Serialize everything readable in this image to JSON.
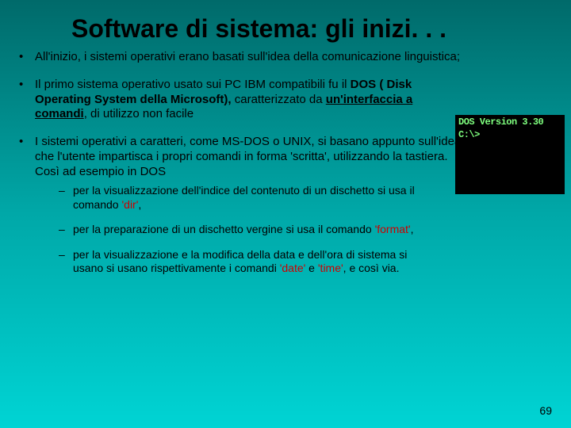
{
  "title": "Software di sistema: gli inizi. . .",
  "bullets": {
    "b1": "All'inizio, i sistemi operativi erano basati sull'idea della comunicazione linguistica;",
    "b2_pre": "Il primo sistema operativo usato sui PC IBM compatibili fu il ",
    "b2_bold": "DOS ( Disk Operating System della Microsoft),",
    "b2_mid": " caratterizzato da ",
    "b2_under": "un'interfaccia a comandi",
    "b2_post": ", di utilizzo non facile",
    "b3": "I sistemi operativi a caratteri, come MS-DOS o UNIX, si basano appunto sull'idea che l'utente impartisca i propri comandi in forma 'scritta', utilizzando la tastiera. Così ad esempio in DOS"
  },
  "sub": {
    "s1a": "per la visualizzazione dell'indice del contenuto di un dischetto si usa il comando ",
    "s1cmd": "'dir'",
    "s1b": ",",
    "s2a": "per la preparazione di un dischetto vergine si usa il comando ",
    "s2cmd": "'format'",
    "s2b": ",",
    "s3a": "per la visualizzazione e la modifica della data e dell'ora di sistema si usano si usano rispettivamente i comandi ",
    "s3cmd1": "'date'",
    "s3mid": " e ",
    "s3cmd2": "'time'",
    "s3b": ", e così via."
  },
  "dos": {
    "line1": "DOS Version 3.30",
    "line2": "C:\\>"
  },
  "slidenum": "69"
}
